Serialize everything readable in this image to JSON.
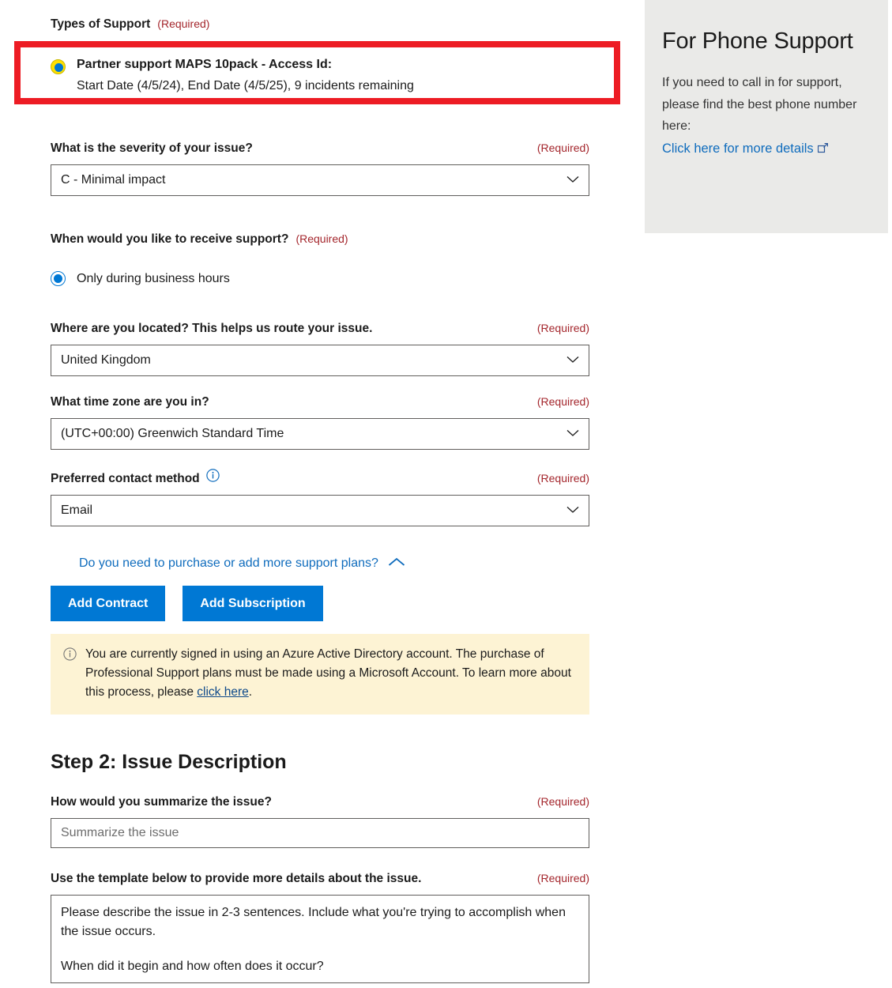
{
  "phone_panel": {
    "title": "For Phone Support",
    "body": "If you need to call in for support, please find the best phone number here:",
    "link_label": "Click here for more details",
    "external_icon": "external-link-icon"
  },
  "types_of_support": {
    "label": "Types of Support",
    "required": "(Required)",
    "selected_plan": {
      "title": "Partner support MAPS 10pack - Access Id:",
      "details": "Start Date (4/5/24), End Date (4/5/25), 9 incidents remaining",
      "radio_state": "selected-highlighted"
    },
    "highlight_color": "#ed1c24"
  },
  "severity": {
    "label": "What is the severity of your issue?",
    "required": "(Required)",
    "value": "C - Minimal impact",
    "chevron": "chevron-down-icon"
  },
  "support_time": {
    "label": "When would you like to receive support?",
    "required": "(Required)",
    "option_label": "Only during business hours",
    "radio_state": "selected"
  },
  "location": {
    "label": "Where are you located? This helps us route your issue.",
    "required": "(Required)",
    "value": "United Kingdom",
    "chevron": "chevron-down-icon"
  },
  "timezone": {
    "label": "What time zone are you in?",
    "required": "(Required)",
    "value": "(UTC+00:00) Greenwich Standard Time",
    "chevron": "chevron-down-icon"
  },
  "contact_method": {
    "label": "Preferred contact method",
    "required": "(Required)",
    "value": "Email",
    "info_icon": "info-icon",
    "chevron": "chevron-down-icon"
  },
  "purchase_plans": {
    "expander_label": "Do you need to purchase or add more support plans?",
    "expander_icon": "chevron-up-icon",
    "add_contract_label": "Add Contract",
    "add_subscription_label": "Add Subscription",
    "accent_color": "#0078d4"
  },
  "notice": {
    "icon": "info-icon",
    "text_before": "You are currently signed in using an Azure Active Directory account. The purchase of Professional Support plans must be made using a Microsoft Account. To learn more about this process, please ",
    "link_label": "click here",
    "text_after": ".",
    "background": "#fdf3d4"
  },
  "step2": {
    "title": "Step 2: Issue Description",
    "summary": {
      "label": "How would you summarize the issue?",
      "required": "(Required)",
      "placeholder": "Summarize the issue",
      "value": ""
    },
    "details": {
      "label": "Use the template below to provide more details about the issue.",
      "required": "(Required)",
      "line1": "Please describe the issue in 2-3 sentences. Include what you're trying to accomplish when the issue occurs.",
      "line2": "When did it begin and how often does it occur?"
    }
  }
}
